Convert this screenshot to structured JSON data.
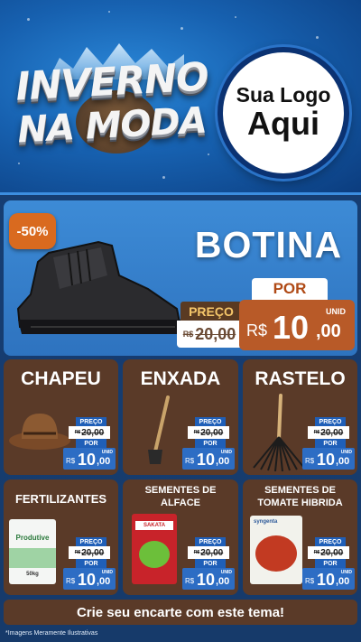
{
  "header": {
    "campaign_line1": "INVERNO",
    "campaign_line2": "NA MODA",
    "brand_line1": "Sua Logo",
    "brand_line2": "Aqui"
  },
  "hero": {
    "discount": "-50%",
    "title": "BOTINA",
    "preco_label": "PREÇO",
    "old_currency": "R$",
    "old_price": "20,00",
    "por_label": "POR",
    "unid_label": "UNID",
    "currency": "R$",
    "price_int": "10",
    "price_dec": ",00"
  },
  "products": [
    {
      "name": "CHAPEU",
      "preco_label": "PREÇO",
      "old_currency": "R$",
      "old_price": "20,00",
      "por_label": "POR",
      "unid_label": "UNID",
      "currency": "R$",
      "price_int": "10",
      "price_dec": ",00"
    },
    {
      "name": "ENXADA",
      "preco_label": "PREÇO",
      "old_currency": "R$",
      "old_price": "20,00",
      "por_label": "POR",
      "unid_label": "UNID",
      "currency": "R$",
      "price_int": "10",
      "price_dec": ",00"
    },
    {
      "name": "RASTELO",
      "preco_label": "PREÇO",
      "old_currency": "R$",
      "old_price": "20,00",
      "por_label": "POR",
      "unid_label": "UNID",
      "currency": "R$",
      "price_int": "10",
      "price_dec": ",00"
    },
    {
      "name": "FERTILIZANTES",
      "preco_label": "PREÇO",
      "old_currency": "R$",
      "old_price": "20,00",
      "por_label": "POR",
      "unid_label": "UNID",
      "currency": "R$",
      "price_int": "10",
      "price_dec": ",00",
      "package_label": "Produtive",
      "package_weight": "50kg"
    },
    {
      "name": "SEMENTES DE\nALFACE",
      "preco_label": "PREÇO",
      "old_currency": "R$",
      "old_price": "20,00",
      "por_label": "POR",
      "unid_label": "UNID",
      "currency": "R$",
      "price_int": "10",
      "price_dec": ",00",
      "package_label": "SAKATA"
    },
    {
      "name": "SEMENTES DE\nTOMATE HIBRIDA",
      "preco_label": "PREÇO",
      "old_currency": "R$",
      "old_price": "20,00",
      "por_label": "POR",
      "unid_label": "UNID",
      "currency": "R$",
      "price_int": "10",
      "price_dec": ",00",
      "package_label": "syngenta"
    }
  ],
  "banner": {
    "text": "Crie seu encarte com este tema!"
  },
  "footnote": {
    "text": "*Imagens Meramente Ilustrativas"
  },
  "colors": {
    "card_bg": "#5a3a28",
    "price_blue": "#2d6dc4",
    "hero_blue": "#3d8bd6",
    "accent_orange": "#b85a28"
  }
}
